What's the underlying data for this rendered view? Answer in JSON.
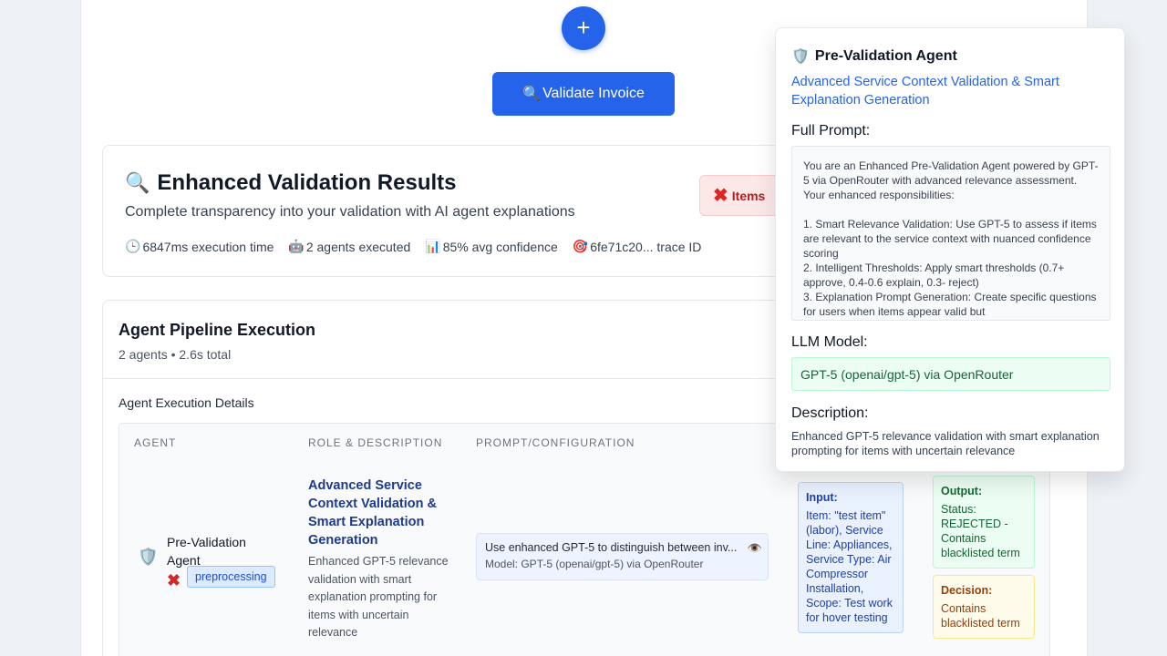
{
  "toolbar": {
    "fab_label": "+",
    "validate_icon": "magnifier-icon",
    "validate_label": "Validate Invoice"
  },
  "results": {
    "title": "Enhanced Validation Results",
    "subtitle": "Complete transparency into your validation with AI agent explanations",
    "metrics": [
      {
        "icon": "clock-icon",
        "text": "6847ms execution time"
      },
      {
        "icon": "robot-icon",
        "text": "2 agents executed"
      },
      {
        "icon": "chart-icon",
        "text": "85% avg confidence"
      },
      {
        "icon": "target-icon",
        "text": "6fe71c20... trace ID"
      }
    ],
    "status_badge": "Items"
  },
  "pipeline": {
    "title": "Agent Pipeline Execution",
    "meta": "2 agents • 2.6s total",
    "details_title": "Agent Execution Details",
    "columns": [
      "AGENT",
      "ROLE & DESCRIPTION",
      "PROMPT/CONFIGURATION"
    ],
    "row": {
      "agent_name": "Pre-Validation Agent",
      "stage": "preprocessing",
      "role_title": "Advanced Service Context Validation & Smart Explanation Generation",
      "role_desc": "Enhanced GPT-5 relevance validation with smart explanation prompting for items with uncertain relevance",
      "prompt_preview": "Use enhanced GPT-5 to distinguish between inv...",
      "prompt_model": "Model: GPT-5 (openai/gpt-5) via OpenRouter",
      "input_label": "Input:",
      "input_text": "Item: \"test item\" (labor), Service Line: Appliances, Service Type: Air Compressor Installation, Scope: Test work for hover testing",
      "output_label": "Output:",
      "output_text": "Status: REJECTED - Contains blacklisted term",
      "decision_label": "Decision:",
      "decision_text": "Contains blacklisted term"
    }
  },
  "tooltip": {
    "title": "Pre-Validation Agent",
    "subtitle": "Advanced Service Context Validation & Smart Explanation Generation",
    "full_prompt_label": "Full Prompt:",
    "full_prompt": "You are an Enhanced Pre-Validation Agent powered by GPT-5 via OpenRouter with advanced relevance assessment. Your enhanced responsibilities:\n\n1. Smart Relevance Validation: Use GPT-5 to assess if items are relevant to the service context with nuanced confidence scoring\n2. Intelligent Thresholds: Apply smart thresholds (0.7+ approve, 0.4-0.6 explain, 0.3- reject)\n3. Explanation Prompt Generation: Create specific questions for users when items appear valid but",
    "llm_label": "LLM Model:",
    "llm_model": "GPT-5 (openai/gpt-5) via OpenRouter",
    "description_label": "Description:",
    "description": "Enhanced GPT-5 relevance validation with smart explanation prompting for items with uncertain relevance"
  }
}
